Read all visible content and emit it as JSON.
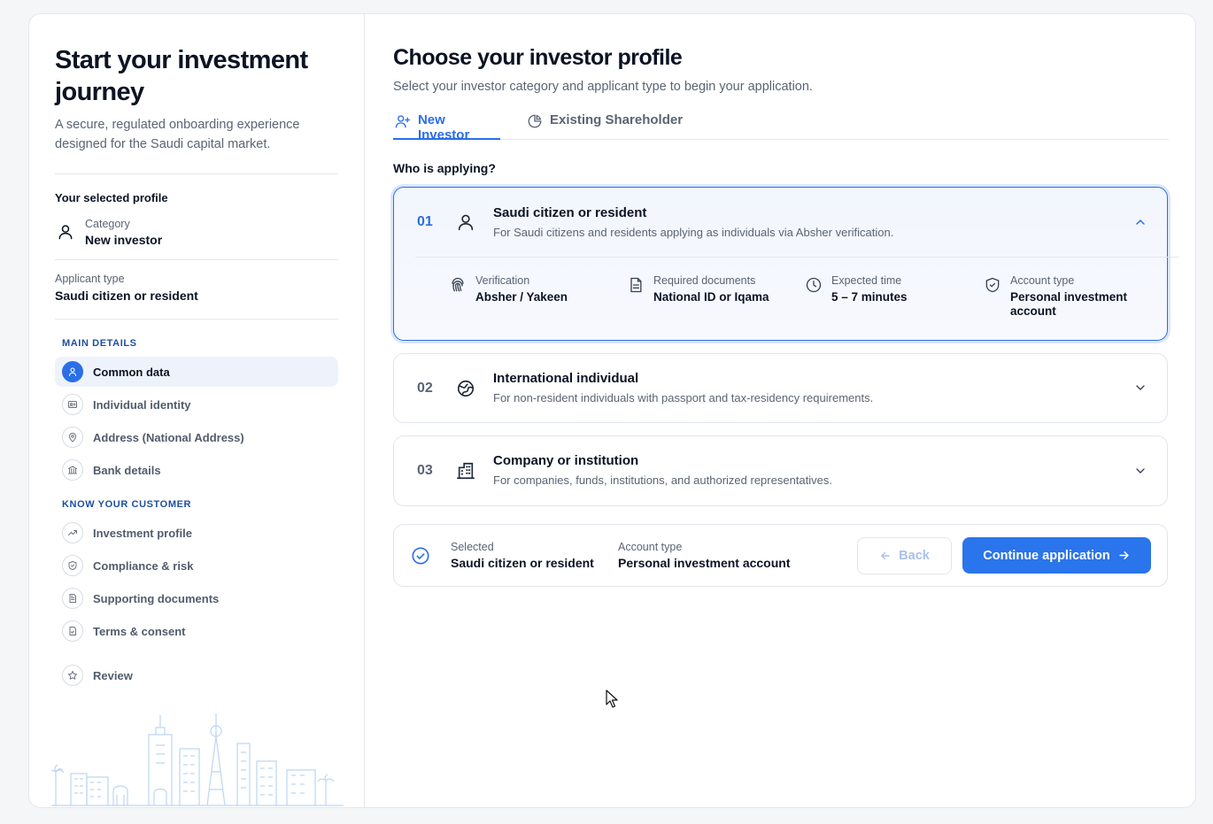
{
  "sidebar": {
    "title": "Start your investment journey",
    "subtitle": "A secure, regulated onboarding experience designed for the Saudi capital market.",
    "selected_profile_title": "Your selected profile",
    "category_label": "Category",
    "category_value": "New investor",
    "applicant_label": "Applicant type",
    "applicant_value": "Saudi citizen or resident",
    "sections": [
      {
        "heading": "MAIN DETAILS",
        "items": [
          {
            "label": "Common data",
            "icon": "user-icon",
            "active": true
          },
          {
            "label": "Individual identity",
            "icon": "id-card-icon"
          },
          {
            "label": "Address (National Address)",
            "icon": "map-pin-icon"
          },
          {
            "label": "Bank details",
            "icon": "bank-icon"
          }
        ]
      },
      {
        "heading": "KNOW YOUR CUSTOMER",
        "items": [
          {
            "label": "Investment profile",
            "icon": "trend-icon"
          },
          {
            "label": "Compliance & risk",
            "icon": "shield-icon"
          },
          {
            "label": "Supporting documents",
            "icon": "document-icon"
          },
          {
            "label": "Terms & consent",
            "icon": "file-check-icon"
          }
        ]
      }
    ],
    "review_label": "Review"
  },
  "main": {
    "title": "Choose your investor profile",
    "subtitle": "Select your investor category and applicant type to begin your application.",
    "tabs": [
      {
        "label": "New Investor",
        "active": true
      },
      {
        "label": "Existing Shareholder",
        "active": false
      }
    ],
    "who_label": "Who is applying?",
    "options": [
      {
        "number": "01",
        "title": "Saudi citizen or resident",
        "description": "For Saudi citizens and residents applying as individuals via Absher verification.",
        "expanded": true,
        "details": [
          {
            "label": "Verification",
            "value": "Absher / Yakeen",
            "icon": "fingerprint-icon"
          },
          {
            "label": "Required documents",
            "value": "National ID or Iqama",
            "icon": "document-icon"
          },
          {
            "label": "Expected time",
            "value": "5 – 7 minutes",
            "icon": "clock-icon"
          },
          {
            "label": "Account type",
            "value": "Personal investment account",
            "icon": "shield-check-icon"
          }
        ]
      },
      {
        "number": "02",
        "title": "International individual",
        "description": "For non-resident individuals with passport and tax-residency requirements."
      },
      {
        "number": "03",
        "title": "Company or institution",
        "description": "For companies, funds, institutions, and authorized representatives."
      }
    ],
    "summary": {
      "selected_label": "Selected",
      "selected_value": "Saudi citizen or resident",
      "account_label": "Account type",
      "account_value": "Personal investment account",
      "back_label": "Back",
      "continue_label": "Continue application"
    }
  },
  "colors": {
    "accent": "#2a74ec",
    "heading": "#1e4fa0",
    "muted": "#5b6474"
  }
}
